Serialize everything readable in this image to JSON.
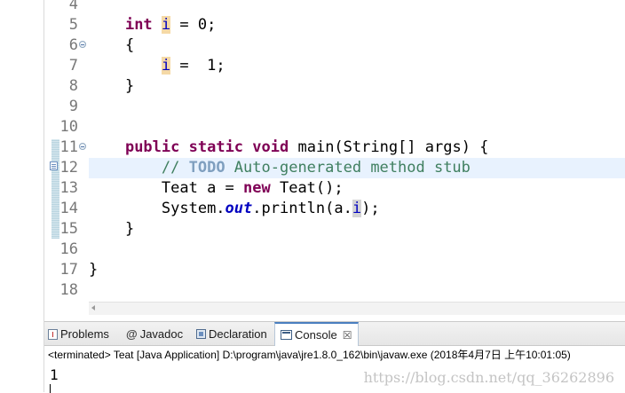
{
  "editor": {
    "line_numbers": [
      "4",
      "5",
      "6",
      "7",
      "8",
      "9",
      "10",
      "11",
      "12",
      "13",
      "14",
      "15",
      "16",
      "17",
      "18"
    ],
    "code": {
      "l5_kw": "int",
      "l5_var": "i",
      "l5_rest": " = 0;",
      "l6": "{",
      "l7_var": "i",
      "l7_rest": " =  1;",
      "l8": "}",
      "l11_kw1": "public",
      "l11_kw2": "static",
      "l11_kw3": "void",
      "l11_rest": " main(String[] args) {",
      "l12_comment_start": "// ",
      "l12_todo": "TODO",
      "l12_comment_rest": " Auto-generated method stub",
      "l13_type": "Teat a = ",
      "l13_kw": "new",
      "l13_rest": " Teat();",
      "l14_a": "System.",
      "l14_out": "out",
      "l14_b": ".println(a.",
      "l14_field": "i",
      "l14_c": ");",
      "l15": "}",
      "l17": "}"
    }
  },
  "panel": {
    "tabs": [
      {
        "label": "Problems",
        "icon": "problems-icon"
      },
      {
        "label": "Javadoc",
        "icon": "javadoc-icon",
        "glyph": "@"
      },
      {
        "label": "Declaration",
        "icon": "declaration-icon"
      },
      {
        "label": "Console",
        "icon": "console-icon",
        "close": "☒"
      }
    ],
    "status": "<terminated> Teat [Java Application] D:\\program\\java\\jre1.8.0_162\\bin\\javaw.exe (2018年4月7日 上午10:01:05)",
    "output": "1",
    "watermark": "https://blog.csdn.net/qq_36262896"
  },
  "colors": {
    "keyword": "#7f0055",
    "field": "#0000c0",
    "comment": "#3f7f5f",
    "todo": "#7f9fbf",
    "current_line": "#e8f2fe",
    "active_tab_accent": "#4a7fc0"
  }
}
